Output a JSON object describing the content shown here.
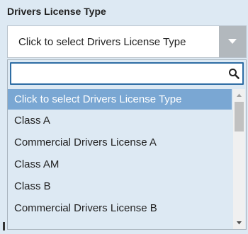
{
  "field": {
    "label": "Drivers License Type",
    "selected_value": "Click to select Drivers License Type"
  },
  "dropdown": {
    "search_value": "",
    "options": [
      "Click to select Drivers License Type",
      "Class A",
      "Commercial Drivers License A",
      "Class AM",
      "Class B",
      "Commercial Drivers License B"
    ],
    "highlighted_index": 0
  },
  "icons": {
    "arrow": "chevron-down-icon",
    "search": "search-icon"
  },
  "colors": {
    "panel_bg": "#dde9f3",
    "highlight_bg": "#7aa7d3",
    "focus_border": "#2e6da4",
    "arrow_button": "#b2b8bd"
  }
}
